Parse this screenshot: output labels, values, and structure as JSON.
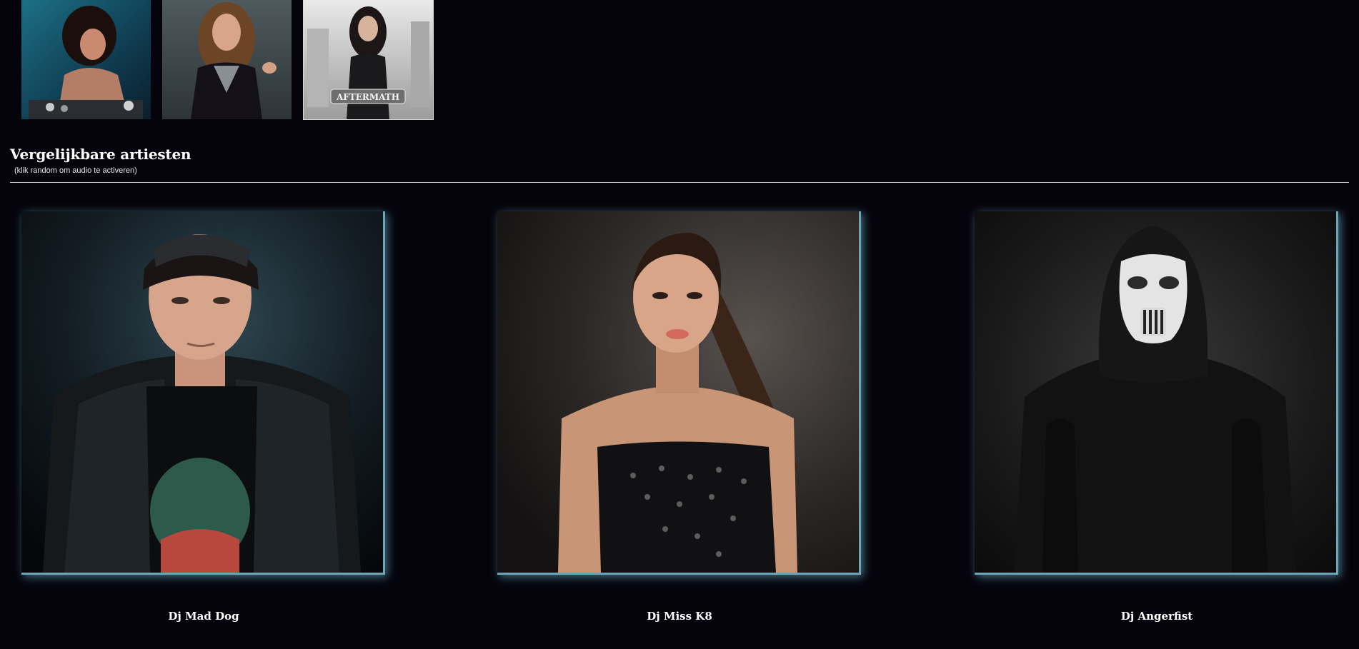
{
  "gallery": {
    "thumbnails": [
      {
        "icon": "dj-at-decks-photo"
      },
      {
        "icon": "portrait-photo"
      },
      {
        "icon": "aftermath-poster-photo",
        "poster_text": "AFTERMATH"
      }
    ]
  },
  "similar_artists": {
    "title": "Vergelijkbare artiesten",
    "subtitle": "(klik random om audio te activeren)",
    "artists": [
      {
        "name": "Dj Mad Dog",
        "icon": "artist-photo"
      },
      {
        "name": "Dj Miss K8",
        "icon": "artist-photo"
      },
      {
        "name": "Dj Angerfist",
        "icon": "artist-photo"
      }
    ]
  },
  "colors": {
    "background": "#05040c",
    "accent_glow": "#6fa4b6",
    "divider": "#d9d9d9"
  }
}
